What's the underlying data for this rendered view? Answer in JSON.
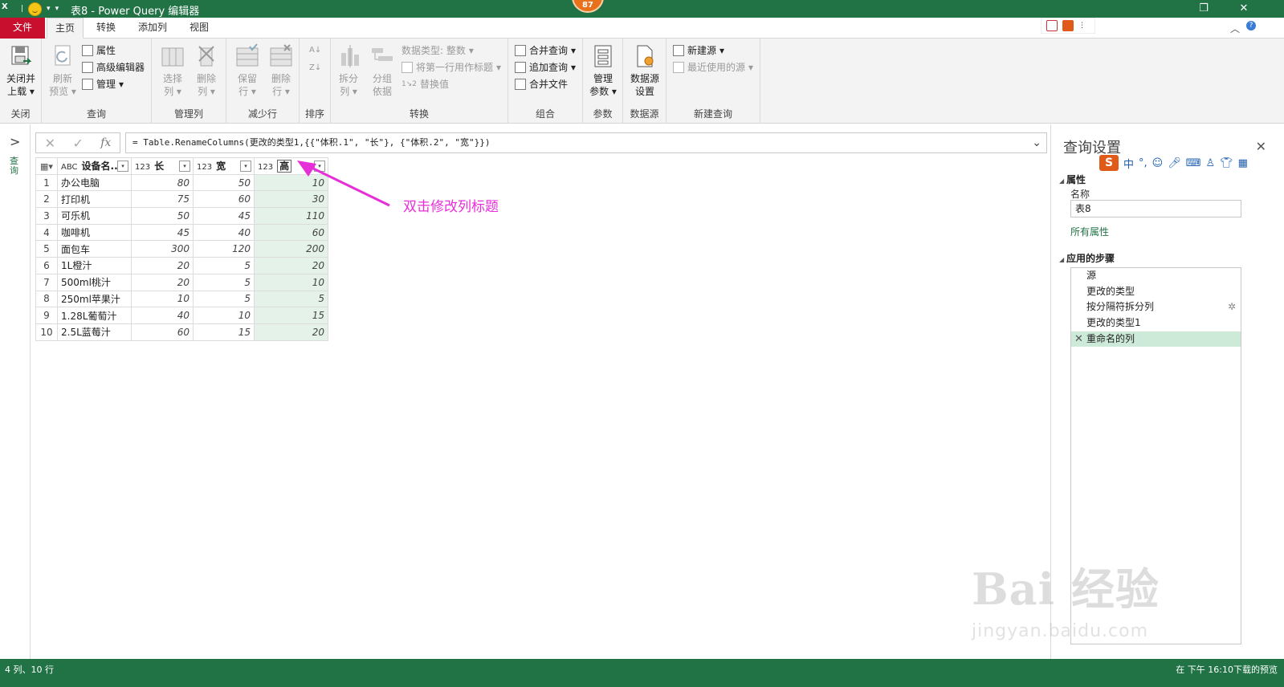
{
  "titlebar": {
    "app_icon": "X",
    "title": "表8 - Power Query 编辑器",
    "badge": "87",
    "restore_glyph": "❐",
    "close_glyph": "✕"
  },
  "tabs": {
    "file": "文件",
    "home": "主页",
    "transform": "转换",
    "add_column": "添加列",
    "view": "视图"
  },
  "ribbon": {
    "close_group": {
      "button": "关闭并",
      "button2": "上载",
      "label": "关闭"
    },
    "query_group": {
      "refresh": "刷新",
      "preview": "预览",
      "properties": "属性",
      "advanced_editor": "高级编辑器",
      "manage": "管理",
      "label": "查询"
    },
    "columns_group": {
      "choose": "选择",
      "choose2": "列",
      "remove": "删除",
      "remove2": "列",
      "label": "管理列"
    },
    "rows_group": {
      "keep": "保留",
      "keep2": "行",
      "remove": "删除",
      "remove2": "行",
      "label": "减少行"
    },
    "sort_group": {
      "label": "排序"
    },
    "transform_group": {
      "split": "拆分",
      "split2": "列",
      "group_by": "分组",
      "group_by2": "依据",
      "data_type": "数据类型: 整数",
      "first_row": "将第一行用作标题",
      "replace": "替换值",
      "label": "转换"
    },
    "combine_group": {
      "merge": "合并查询",
      "append": "追加查询",
      "combine_files": "合并文件",
      "label": "组合"
    },
    "params_group": {
      "manage": "管理",
      "manage2": "参数",
      "label": "参数"
    },
    "datasource_group": {
      "settings": "数据源",
      "settings2": "设置",
      "label": "数据源"
    },
    "newquery_group": {
      "new_source": "新建源",
      "recent": "最近使用的源",
      "label": "新建查询"
    }
  },
  "leftnav": {
    "label": "查询"
  },
  "formula": {
    "text": "= Table.RenameColumns(更改的类型1,{{\"体积.1\", \"长\"}, {\"体积.2\", \"宽\"}})"
  },
  "grid": {
    "columns": [
      {
        "type": "ABC",
        "name": "设备名..."
      },
      {
        "type": "123",
        "name": "长"
      },
      {
        "type": "123",
        "name": "宽"
      },
      {
        "type": "123",
        "name": "高"
      }
    ],
    "rows": [
      [
        "1",
        "办公电脑",
        "80",
        "50",
        "10"
      ],
      [
        "2",
        "打印机",
        "75",
        "60",
        "30"
      ],
      [
        "3",
        "可乐机",
        "50",
        "45",
        "110"
      ],
      [
        "4",
        "咖啡机",
        "45",
        "40",
        "60"
      ],
      [
        "5",
        "面包车",
        "300",
        "120",
        "200"
      ],
      [
        "6",
        "1L橙汁",
        "20",
        "5",
        "20"
      ],
      [
        "7",
        "500ml桃汁",
        "20",
        "5",
        "10"
      ],
      [
        "8",
        "250ml苹果汁",
        "10",
        "5",
        "5"
      ],
      [
        "9",
        "1.28L葡萄汁",
        "40",
        "10",
        "15"
      ],
      [
        "10",
        "2.5L蓝莓汁",
        "60",
        "15",
        "20"
      ]
    ]
  },
  "annotation": {
    "text": "双击修改列标题",
    "color": "#e72fd9"
  },
  "query_settings": {
    "title": "查询设置",
    "properties_header": "属性",
    "name_label": "名称",
    "name_value": "表8",
    "all_properties": "所有属性",
    "steps_header": "应用的步骤",
    "steps": [
      "源",
      "更改的类型",
      "按分隔符拆分列",
      "更改的类型1",
      "重命名的列"
    ]
  },
  "ime": {
    "s": "S",
    "lang": "中"
  },
  "status": {
    "left": "4 列、10 行",
    "right": "在 下午 16:10下载的预览"
  },
  "watermark": {
    "brand": "Bai 经验",
    "url": "jingyan.baidu.com"
  },
  "colors": {
    "excel_green": "#217346",
    "file_red": "#c8102e",
    "selected_column": "#e5f2e9",
    "annotation_magenta": "#e72fd9"
  }
}
